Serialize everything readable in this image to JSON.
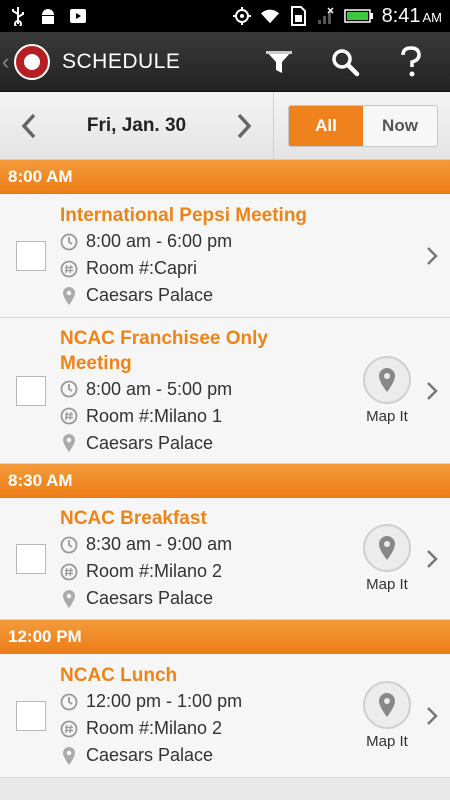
{
  "status": {
    "time": "8:41",
    "ampm": "AM"
  },
  "header": {
    "title": "SCHEDULE"
  },
  "datebar": {
    "date": "Fri, Jan. 30",
    "filter_all": "All",
    "filter_now": "Now"
  },
  "sections": [
    {
      "time": "8:00  AM"
    },
    {
      "time": "8:30  AM"
    },
    {
      "time": "12:00  PM"
    }
  ],
  "events": [
    {
      "title": "International Pepsi Meeting",
      "time": "8:00 am - 6:00 pm",
      "room": "Room #:Capri",
      "location": "Caesars Palace"
    },
    {
      "title": "NCAC Franchisee Only Meeting",
      "time": "8:00 am - 5:00 pm",
      "room": "Room #:Milano 1",
      "location": "Caesars Palace",
      "map_label": "Map It"
    },
    {
      "title": "NCAC Breakfast",
      "time": "8:30 am - 9:00 am",
      "room": "Room #:Milano 2",
      "location": "Caesars Palace",
      "map_label": "Map It"
    },
    {
      "title": "NCAC Lunch",
      "time": "12:00 pm - 1:00 pm",
      "room": "Room #:Milano 2",
      "location": "Caesars Palace",
      "map_label": "Map It"
    }
  ],
  "colors": {
    "accent": "#ee8418",
    "section": "#ec7d16"
  }
}
